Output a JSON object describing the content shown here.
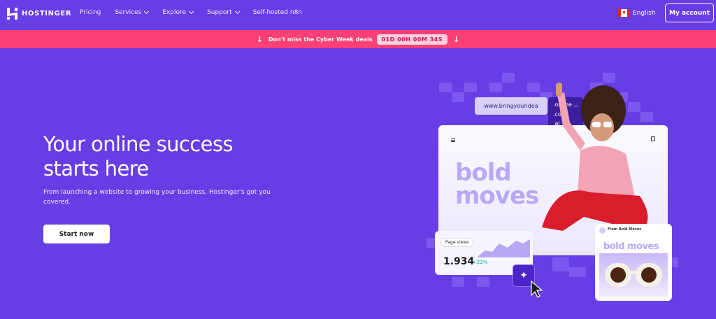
{
  "nav": {
    "brand": "HOSTINGER",
    "items": [
      {
        "label": "Pricing",
        "has_dropdown": false
      },
      {
        "label": "Services",
        "has_dropdown": true
      },
      {
        "label": "Explore",
        "has_dropdown": true
      },
      {
        "label": "Support",
        "has_dropdown": true
      },
      {
        "label": "Self-hosted n8n",
        "has_dropdown": false
      }
    ],
    "language": "English",
    "account_button": "My account"
  },
  "promo": {
    "text": "Don't miss the Cyber Week deals",
    "countdown": "01D 00H 00M 34S",
    "color": "#fc3f76"
  },
  "hero": {
    "title_line1": "Your online success",
    "title_line2": "starts here",
    "subtitle": "From launching a website to growing your business, Hostinger's got you covered.",
    "cta": "Start now",
    "background": "#673de6"
  },
  "illustration": {
    "domain_chip": "www.bringyouridea",
    "tld_options": [
      ".online",
      ".com",
      ".ai"
    ],
    "card_text_line1": "bold",
    "card_text_line2": "moves",
    "page_views_label": "Page views",
    "page_views_value": "1.934",
    "page_views_change": "+22%",
    "social_title": "From Bold Moves",
    "social_text": "bold moves"
  }
}
